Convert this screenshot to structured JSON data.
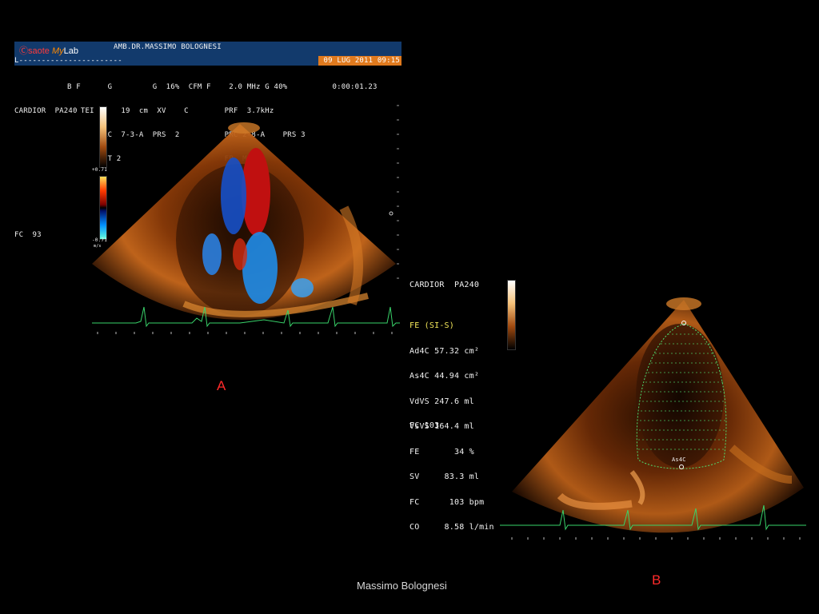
{
  "header": {
    "logo": {
      "brand": "saote",
      "my": "My",
      "lab": "Lab"
    },
    "clinic": "AMB.DR.MASSIMO BOLOGNESI",
    "patient_line": "L-----------------------",
    "datetime": "09 LUG 2011 09:15",
    "params": [
      "B F      G         G  16%  CFM F    2.0 MHz G 40%          0:00:01.23",
      "   TEI P    19  cm  XV    C        PRF  3.7kHz",
      "       PRC  7-3-A  PRS  2          PRC 2-8-A    PRS 3",
      "       PST 2                       FP  M"
    ]
  },
  "panel_a": {
    "probe": "CARDIOR  PA240",
    "hr": "FC  93",
    "scale_top": "+0.71",
    "scale_bottom": "-0.71",
    "scale_unit": "m/s",
    "label": "A"
  },
  "panel_b": {
    "probe": "CARDIOR  PA240",
    "measure_title": "FE (SI-S)",
    "measurements": [
      "Ad4C 57.32 cm²",
      "As4C 44.94 cm²",
      "VdVS 247.6 ml",
      "VsVS 164.4 ml",
      "FE       34 %",
      "SV     83.3 ml",
      "FC      103 bpm",
      "CO     8.58 l/min"
    ],
    "hr": "FC 103",
    "trace_label": "As4C",
    "label": "B"
  },
  "footer": "Massimo Bolognesi",
  "colors": {
    "header_bg": "#123a6c",
    "date_bg": "#e07a1e",
    "label_red": "#ff2a2a",
    "ecg": "#39d36a",
    "highlight": "#f5e85a"
  }
}
